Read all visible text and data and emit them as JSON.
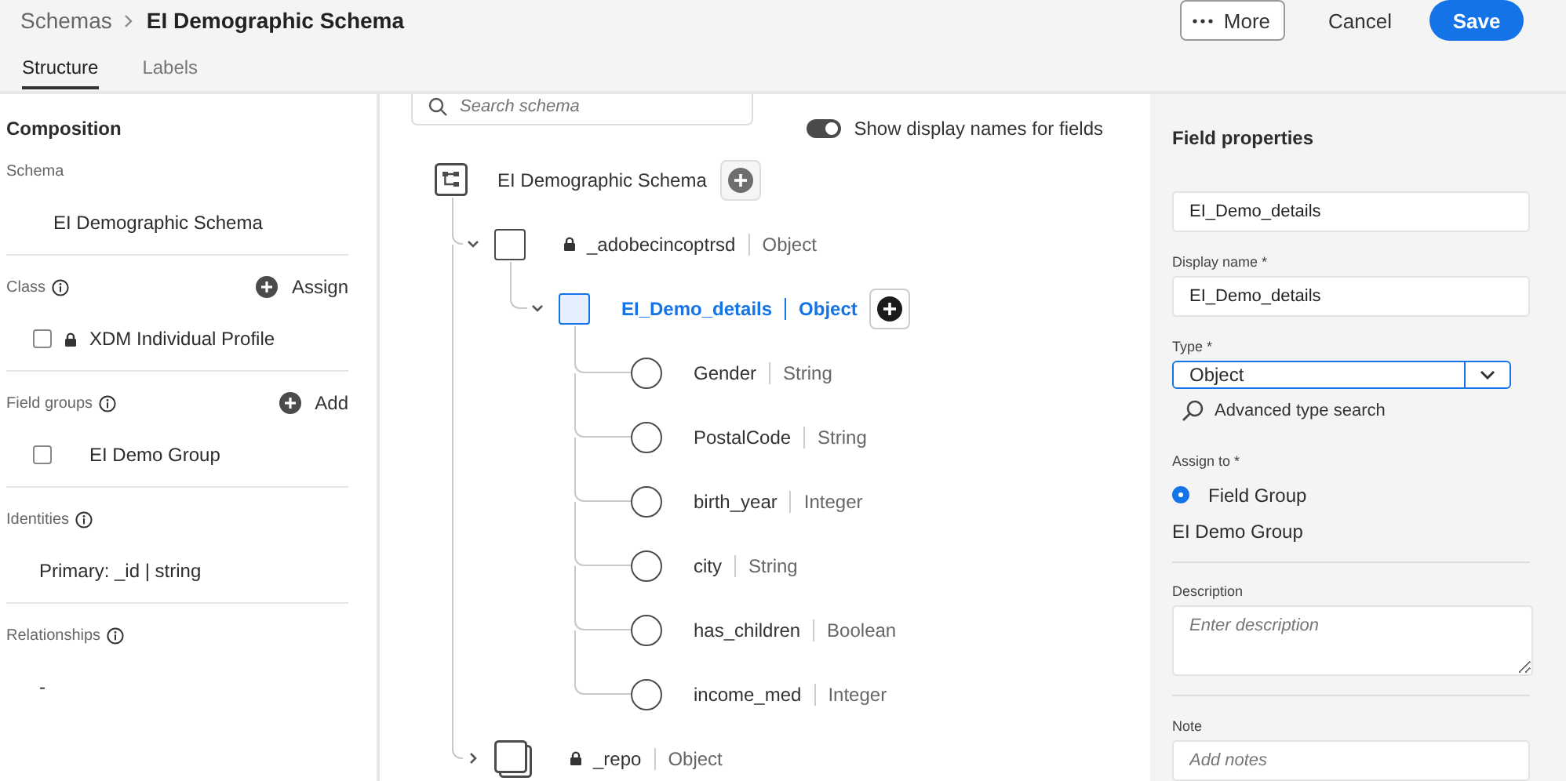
{
  "header": {
    "breadcrumb": [
      "Schemas",
      "EI Demographic Schema"
    ],
    "buttons": [
      {
        "kind": "more",
        "label": "More"
      },
      {
        "kind": "quiet",
        "label": "Cancel"
      },
      {
        "kind": "primary",
        "label": "Save"
      }
    ],
    "tabs": [
      {
        "label": "Structure",
        "selected": true
      },
      {
        "label": "Labels",
        "selected": false
      }
    ]
  },
  "composition": {
    "title": "Composition",
    "sections": [
      {
        "label": "Schema",
        "info": false,
        "items": [
          {
            "kind": "text",
            "label": "EI Demographic Schema"
          }
        ]
      },
      {
        "label": "Class",
        "info": true,
        "action": "Assign",
        "items": [
          {
            "kind": "checkbox",
            "label": "XDM Individual Profile",
            "checked": false,
            "locked": true
          }
        ]
      },
      {
        "label": "Field groups",
        "info": true,
        "action": "Add",
        "items": [
          {
            "kind": "checkbox",
            "label": "EI Demo Group",
            "checked": false,
            "locked": false
          }
        ]
      },
      {
        "label": "Identities",
        "info": true,
        "items": [
          {
            "kind": "text",
            "label": "Primary: _id | string"
          }
        ]
      },
      {
        "label": "Relationships",
        "info": true,
        "items": [
          {
            "kind": "text",
            "label": "-"
          }
        ]
      }
    ]
  },
  "canvas": {
    "search": {
      "placeholder": "Search schema"
    },
    "toggle": {
      "label": "Show display names for fields",
      "on": true
    },
    "tree": {
      "name": "EI Demographic Schema",
      "kind": "schema",
      "selected": false,
      "children": [
        {
          "name": "_adobecincoptrsd",
          "type": "Object",
          "kind": "object",
          "locked": true,
          "expanded": true,
          "selected": false,
          "children": [
            {
              "name": "EI_Demo_details",
              "type": "Object",
              "kind": "object",
              "locked": false,
              "expanded": true,
              "selected": true,
              "children": [
                {
                  "name": "Gender",
                  "type": "String",
                  "kind": "field",
                  "selected": false
                },
                {
                  "name": "PostalCode",
                  "type": "String",
                  "kind": "field",
                  "selected": false
                },
                {
                  "name": "birth_year",
                  "type": "Integer",
                  "kind": "field",
                  "selected": false
                },
                {
                  "name": "city",
                  "type": "String",
                  "kind": "field",
                  "selected": false
                },
                {
                  "name": "has_children",
                  "type": "Boolean",
                  "kind": "field",
                  "selected": false
                },
                {
                  "name": "income_med",
                  "type": "Integer",
                  "kind": "field",
                  "selected": false
                }
              ]
            }
          ]
        },
        {
          "name": "_repo",
          "type": "Object",
          "kind": "array",
          "locked": true,
          "expanded": false,
          "selected": false
        }
      ]
    }
  },
  "properties": {
    "title": "Field properties",
    "field_name": {
      "value": "EI_Demo_details"
    },
    "display_name": {
      "label": "Display name *",
      "value": "EI_Demo_details"
    },
    "type": {
      "label": "Type *",
      "value": "Object"
    },
    "advanced_search": "Advanced type search",
    "assign_to": {
      "label": "Assign to *",
      "options": [
        {
          "label": "Field Group",
          "selected": true
        }
      ],
      "group": "EI Demo Group"
    },
    "description": {
      "label": "Description",
      "placeholder": "Enter description"
    },
    "note": {
      "label": "Note",
      "placeholder": "Add notes"
    }
  }
}
